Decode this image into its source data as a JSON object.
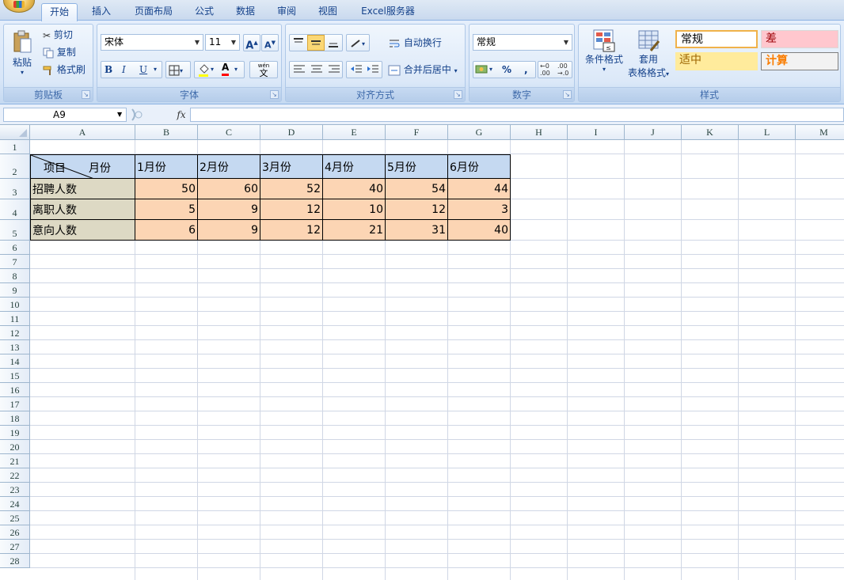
{
  "tabs": [
    "开始",
    "插入",
    "页面布局",
    "公式",
    "数据",
    "审阅",
    "视图",
    "Excel服务器"
  ],
  "clipboard": {
    "paste": "粘贴",
    "cut": "剪切",
    "copy": "复制",
    "format_painter": "格式刷",
    "label": "剪贴板"
  },
  "font": {
    "name": "宋体",
    "size": "11",
    "bold": "B",
    "italic": "I",
    "underline": "U",
    "grow": "A",
    "shrink": "A",
    "font_color_letter": "A",
    "phonetic": "wén",
    "phonetic2": "文",
    "label": "字体"
  },
  "alignment": {
    "wrap": "自动换行",
    "merge": "合并后居中",
    "label": "对齐方式"
  },
  "number": {
    "format": "常规",
    "percent": "%",
    "comma": ",",
    "label": "数字"
  },
  "styles": {
    "conditional": "条件格式",
    "table_line1": "套用",
    "table_line2": "表格格式",
    "label": "样式",
    "cells": [
      {
        "text": "常规",
        "color": "#000000",
        "bg": "#ffffff"
      },
      {
        "text": "差",
        "color": "#9c0006",
        "bg": "#ffc7ce"
      },
      {
        "text": "适中",
        "color": "#9c6500",
        "bg": "#ffeb9c"
      },
      {
        "text": "计算",
        "color": "#fa7d00",
        "bg": "#f2f2f2"
      }
    ]
  },
  "formula_bar": {
    "name_box": "A9",
    "fx": "fx",
    "formula": ""
  },
  "columns": [
    "A",
    "B",
    "C",
    "D",
    "E",
    "F",
    "G",
    "H",
    "I",
    "J",
    "K",
    "L",
    "M"
  ],
  "rows": [
    "1",
    "2",
    "3",
    "4",
    "5",
    "6",
    "7",
    "8",
    "9",
    "10",
    "11",
    "12",
    "13",
    "14",
    "15",
    "16",
    "17",
    "18",
    "19",
    "20",
    "21",
    "22",
    "23",
    "24",
    "25",
    "26",
    "27",
    "28"
  ],
  "table": {
    "corner_top": "月份",
    "corner_bottom": "项目",
    "months": [
      "1月份",
      "2月份",
      "3月份",
      "4月份",
      "5月份",
      "6月份"
    ],
    "items": [
      {
        "label": "招聘人数",
        "values": [
          "50",
          "60",
          "52",
          "40",
          "54",
          "44"
        ]
      },
      {
        "label": "离职人数",
        "values": [
          "5",
          "9",
          "12",
          "10",
          "12",
          "3"
        ]
      },
      {
        "label": "意向人数",
        "values": [
          "6",
          "9",
          "12",
          "21",
          "31",
          "40"
        ]
      }
    ],
    "colors": {
      "header_bg": "#c5d9f1",
      "label_bg": "#ddd9c4",
      "value_bg": "#fcd5b4"
    }
  }
}
